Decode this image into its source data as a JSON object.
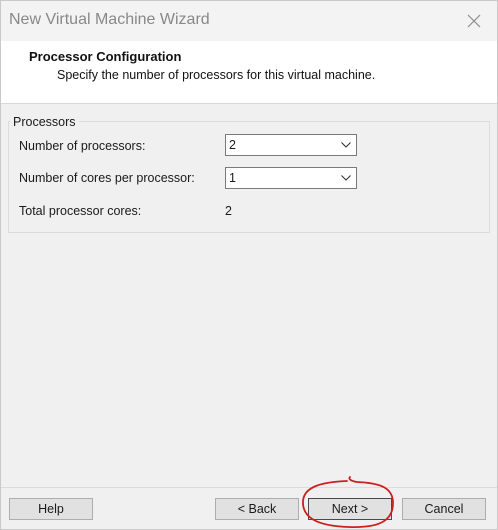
{
  "window": {
    "title": "New Virtual Machine Wizard",
    "close_icon": "close-icon"
  },
  "header": {
    "title": "Processor Configuration",
    "subtitle": "Specify the number of processors for this virtual machine."
  },
  "processors_group": {
    "legend": "Processors",
    "num_processors_label": "Number of processors:",
    "num_processors_value": "2",
    "cores_per_processor_label": "Number of cores per processor:",
    "cores_per_processor_value": "1",
    "total_cores_label": "Total processor cores:",
    "total_cores_value": "2"
  },
  "buttons": {
    "help": "Help",
    "back": "< Back",
    "next": "Next >",
    "cancel": "Cancel"
  },
  "annotation": {
    "color": "#cc1f1f",
    "target": "next-button"
  }
}
